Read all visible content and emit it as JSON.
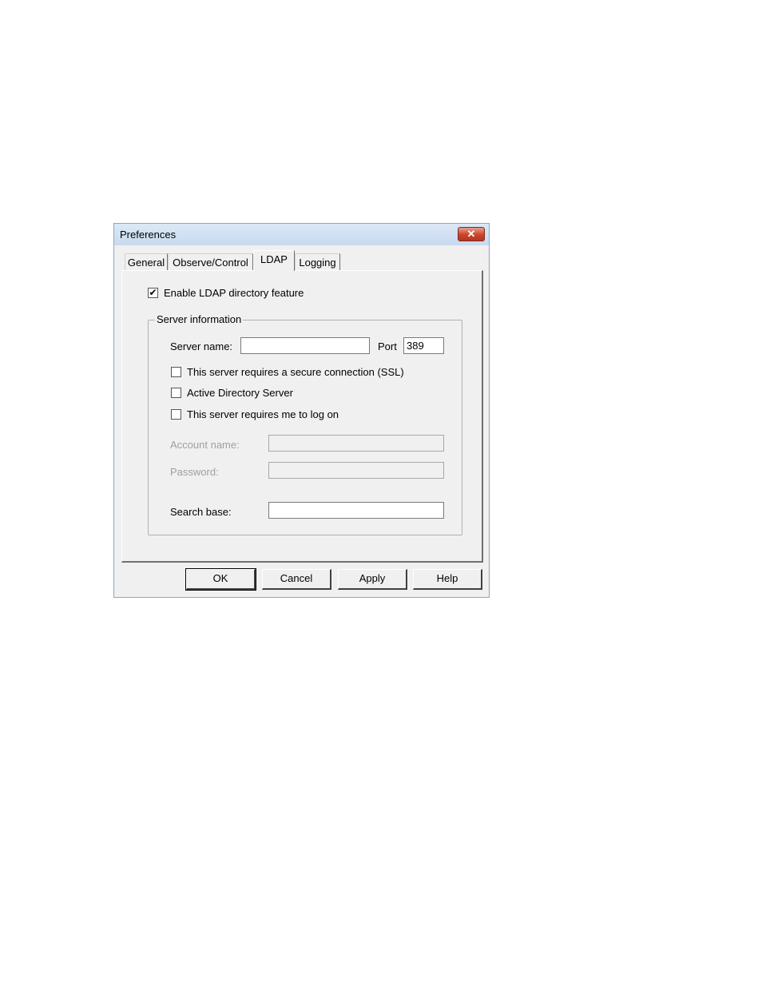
{
  "window": {
    "title": "Preferences",
    "close_glyph": "✕"
  },
  "tabs": [
    {
      "label": "General"
    },
    {
      "label": "Observe/Control"
    },
    {
      "label": "LDAP"
    },
    {
      "label": "Logging"
    }
  ],
  "ldap": {
    "enable_label": "Enable LDAP directory feature",
    "enable_checked": true,
    "group_title": "Server information",
    "server_name_label": "Server name:",
    "server_name_value": "",
    "port_label": "Port",
    "port_value": "389",
    "ssl_label": "This server requires a secure connection (SSL)",
    "ad_label": "Active Directory Server",
    "logon_label": "This server requires me to log on",
    "account_label": "Account name:",
    "account_value": "",
    "password_label": "Password:",
    "password_value": "",
    "search_base_label": "Search base:",
    "search_base_value": ""
  },
  "buttons": {
    "ok": "OK",
    "cancel": "Cancel",
    "apply": "Apply",
    "help": "Help"
  }
}
